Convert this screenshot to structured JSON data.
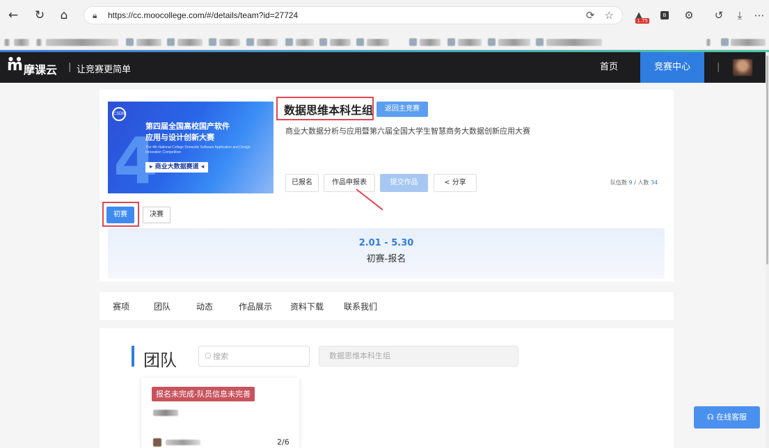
{
  "browser": {
    "url": "https://cc.moocollege.com/#/details/team?id=27724",
    "extension_badge": "1.75",
    "extension_letter": "B"
  },
  "header": {
    "logo_text": "摩课云",
    "slogan": "让竞赛更简单",
    "nav_home": "首页",
    "nav_competition": "竞赛中心"
  },
  "competition": {
    "banner_line1": "第四届全国高校国产软件",
    "banner_line2": "应用与设计创新大赛",
    "banner_en": "The 4th National College Domestic Software Application and Design Innovation Competition",
    "banner_tag": "▸ 商业大数据赛道 ◂",
    "banner_badge": "CSDIC",
    "title": "数据思维本科生组",
    "back_button": "返回主竞赛",
    "subtitle": "商业大数据分析与应用暨第六届全国大学生智慧商务大数据创新应用大赛",
    "actions": {
      "registered": "已报名",
      "application_form": "作品申报表",
      "submit_work": "提交作品",
      "share": "分享"
    },
    "team_stats": {
      "teams_label": "队伍数",
      "teams_value": "9",
      "people_label": "人数",
      "people_value": "34"
    },
    "rounds": {
      "preliminary": "初赛",
      "final": "决赛"
    },
    "timeline": {
      "date": "2.01 - 5.30",
      "label": "初赛-报名"
    }
  },
  "tabs": [
    "赛项",
    "团队",
    "动态",
    "作品展示",
    "资料下载",
    "联系我们"
  ],
  "team_section": {
    "heading": "团队",
    "search_placeholder": "搜索",
    "group_name": "数据思维本科生组",
    "team_card": {
      "status": "报名未完成-队员信息未完善",
      "member_count": "2/6"
    }
  },
  "online_service": "在线客服"
}
